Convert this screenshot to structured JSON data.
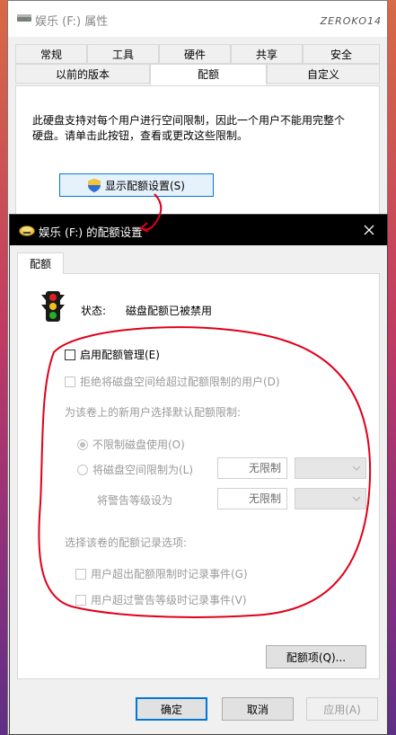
{
  "back_window": {
    "title": "娱乐 (F:) 属性",
    "watermark": "ZEROKO14",
    "tabs_row1": [
      "常规",
      "工具",
      "硬件",
      "共享",
      "安全"
    ],
    "tabs_row2": [
      "以前的版本",
      "配额",
      "自定义"
    ],
    "active_tab": "配额",
    "description": "此硬盘支持对每个用户进行空间限制，因此一个用户不能用完整个硬盘。请单击此按钮，查看或更改这些限制。",
    "show_quota_button": "显示配额设置(S)"
  },
  "quota_window": {
    "title": "娱乐 (F:) 的配额设置",
    "tab": "配额",
    "status_label": "状态:",
    "status_value": "磁盘配额已被禁用",
    "enable_quota": "启用配额管理(E)",
    "deny_space": "拒绝将磁盘空间给超过配额限制的用户(D)",
    "default_limit_heading": "为该卷上的新用户选择默认配额限制:",
    "no_limit_option": "不限制磁盘使用(O)",
    "limit_option": "将磁盘空间限制为(L)",
    "limit_value": "无限制",
    "warning_label": "将警告等级设为",
    "warning_value": "无限制",
    "logging_heading": "选择该卷的配额记录选项:",
    "log_exceed_limit": "用户超出配额限制时记录事件(G)",
    "log_exceed_warning": "用户超过警告等级时记录事件(V)",
    "quota_entries_button": "配额项(Q)...",
    "ok_button": "确定",
    "cancel_button": "取消",
    "apply_button": "应用(A)"
  },
  "colors": {
    "accent": "#0078d7",
    "annotation": "#e0001b",
    "titlebar_front": "#000000"
  }
}
